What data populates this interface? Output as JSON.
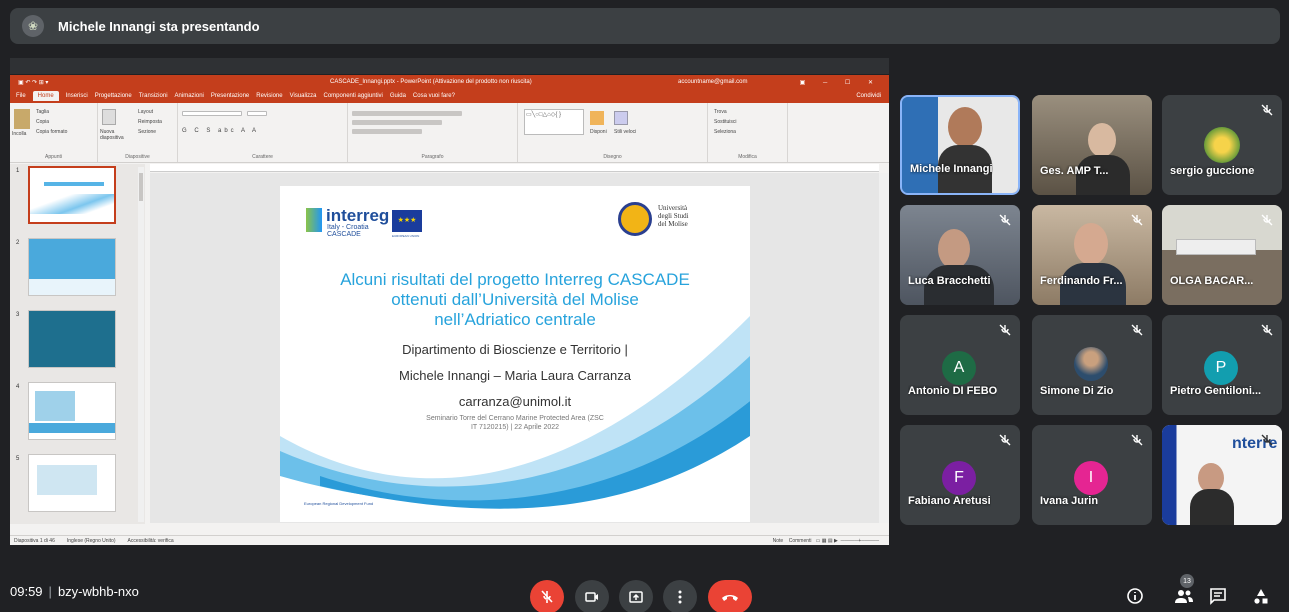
{
  "banner": {
    "presenting_text": "Michele Innangi sta presentando"
  },
  "ppt": {
    "window_title": "CASCADE_Innangi.pptx - PowerPoint (Attivazione del prodotto non riuscita)",
    "account": "accountname@gmail.com",
    "menu": [
      "File",
      "Home",
      "Inserisci",
      "Progettazione",
      "Transizioni",
      "Animazioni",
      "Presentazione",
      "Revisione",
      "Visualizza",
      "Componenti aggiuntivi",
      "Guida",
      "Cosa vuoi fare?"
    ],
    "share_label": "Condividi",
    "ribbon_groups": [
      "Appunti",
      "Diapositive",
      "Carattere",
      "Paragrafo",
      "Disegno",
      "Modifica"
    ],
    "ribbon_items": {
      "incolla": "Incolla",
      "taglia": "Taglia",
      "copia": "Copia",
      "copia_formato": "Copia formato",
      "nuova": "Nuova diapositiva",
      "layout": "Layout",
      "reimposta": "Reimposta",
      "sezione": "Sezione",
      "forme": "Forme",
      "disponi": "Disponi",
      "stili": "Stili veloci",
      "trova": "Trova",
      "sostituisci": "Sostituisci",
      "seleziona": "Seleziona"
    },
    "thumb_numbers": [
      "1",
      "2",
      "3",
      "4",
      "5"
    ],
    "status_left": "Diapositiva 1 di 46",
    "status_lang": "Inglese (Regno Unito)",
    "status_access": "Accessibilità: verifica",
    "status_notes": "Note",
    "status_comments": "Commenti"
  },
  "slide": {
    "interreg_word": "interreg",
    "interreg_sub1": "Italy - Croatia",
    "interreg_sub2": "CASCADE",
    "eu_label": "EUROPEAN UNION",
    "uni_line1": "Università",
    "uni_line2": "degli Studi",
    "uni_line3": "del Molise",
    "headline1": "Alcuni risultati del progetto Interreg CASCADE",
    "headline2": "ottenuti dall’Università del Molise",
    "headline3": "nell’Adriatico centrale",
    "dept": "Dipartimento di Bioscienze e Territorio |",
    "authors": "Michele Innangi – Maria Laura Carranza",
    "email": "carranza@unimol.it",
    "seminar1": "Seminario Torre del Cerrano Marine Protected Area (ZSC",
    "seminar2": "IT 7120215) | 22 Aprile 2022",
    "erdf": "European Regional Development Fund"
  },
  "participants": [
    {
      "name": "Michele Innangi",
      "kind": "video"
    },
    {
      "name": "Ges. AMP T...",
      "kind": "video"
    },
    {
      "name": "sergio guccione",
      "kind": "avatar"
    },
    {
      "name": "Luca Bracchetti",
      "kind": "video"
    },
    {
      "name": "Ferdinando Fr...",
      "kind": "video"
    },
    {
      "name": "OLGA BACAR...",
      "kind": "video"
    },
    {
      "name": "Antonio DI FEBO",
      "initial": "A",
      "color": "#1e6b45"
    },
    {
      "name": "Simone Di Zio",
      "kind": "avatar"
    },
    {
      "name": "Pietro Gentiloni...",
      "initial": "P",
      "color": "#129eaf"
    },
    {
      "name": "Fabiano Aretusi",
      "initial": "F",
      "color": "#7b1fa2"
    },
    {
      "name": "Ivana Jurin",
      "initial": "I",
      "color": "#e52592"
    },
    {
      "name": "",
      "kind": "video"
    }
  ],
  "bottom": {
    "time": "09:59",
    "meeting_code": "bzy-wbhb-nxo",
    "people_count": "13"
  },
  "colors": {
    "accent_red": "#ea4335",
    "ppt_red": "#c43e1c",
    "tile_bg": "#3c4043",
    "page_bg": "#202124"
  },
  "icons": [
    "mic-off-icon",
    "camera-icon",
    "present-icon",
    "more-icon",
    "hangup-icon",
    "info-icon",
    "people-icon",
    "chat-icon",
    "activities-icon"
  ]
}
